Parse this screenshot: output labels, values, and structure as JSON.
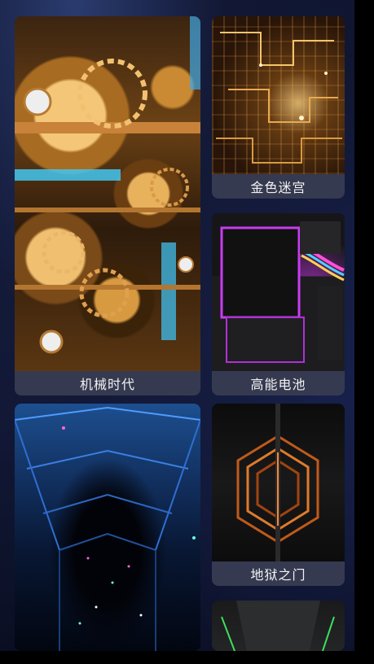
{
  "wallpapers": [
    {
      "label": "机械时代",
      "art": "mechanical-gears-wallpaper"
    },
    {
      "label": "金色迷宫",
      "art": "golden-circuit-wallpaper"
    },
    {
      "label": "高能电池",
      "art": "neon-battery-wallpaper"
    },
    {
      "label": "",
      "art": "blue-tunnel-wallpaper"
    },
    {
      "label": "地狱之门",
      "art": "hell-gate-wallpaper"
    },
    {
      "label": "",
      "art": "green-stripe-wallpaper"
    }
  ]
}
